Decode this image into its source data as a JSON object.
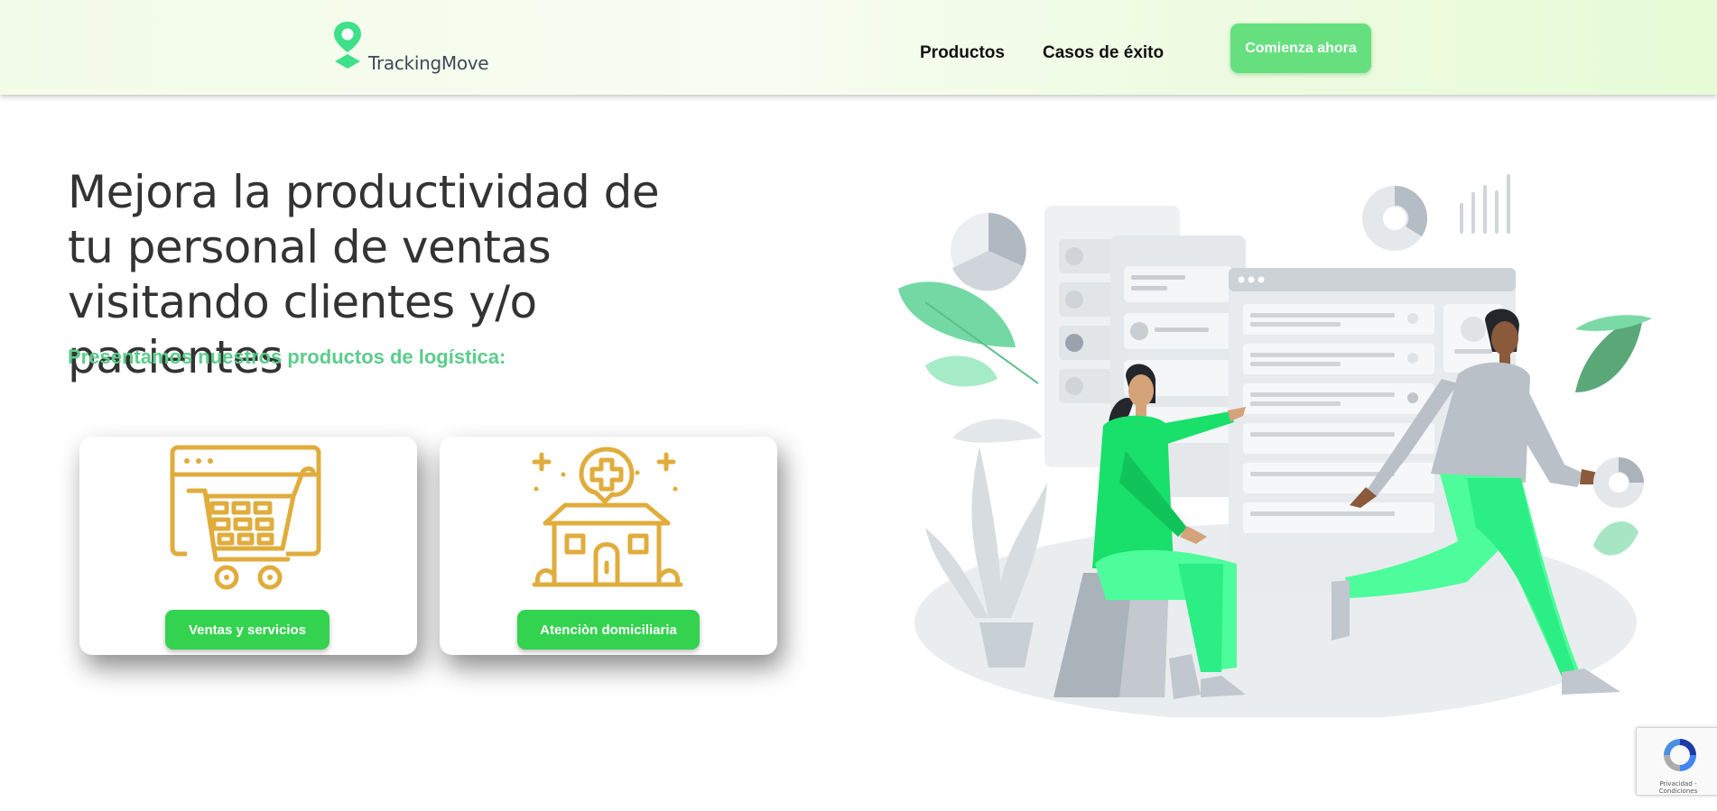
{
  "header": {
    "logo_text": "TrackingMove",
    "nav": [
      {
        "label": "Productos"
      },
      {
        "label": "Casos de éxito"
      }
    ],
    "cta_label": "Comienza ahora"
  },
  "hero": {
    "title": "Mejora la productividad de tu personal de ventas visitando clientes y/o pacientes",
    "subtitle": "Presentamos nuestros productos de logística:"
  },
  "cards": [
    {
      "icon": "shopping-cart-browser-icon",
      "button_label": "Ventas y servicios"
    },
    {
      "icon": "home-health-icon",
      "button_label": "Atenciòn domiciliaria"
    }
  ],
  "recaptcha": {
    "links_text": "Privacidad - Condiciones"
  },
  "colors": {
    "brand_green": "#33d24f",
    "cta_green": "#66e07f",
    "subtitle_green": "#5ccc8b",
    "icon_gold": "#e0ac3c",
    "illustration_green": "#3ee87c"
  }
}
